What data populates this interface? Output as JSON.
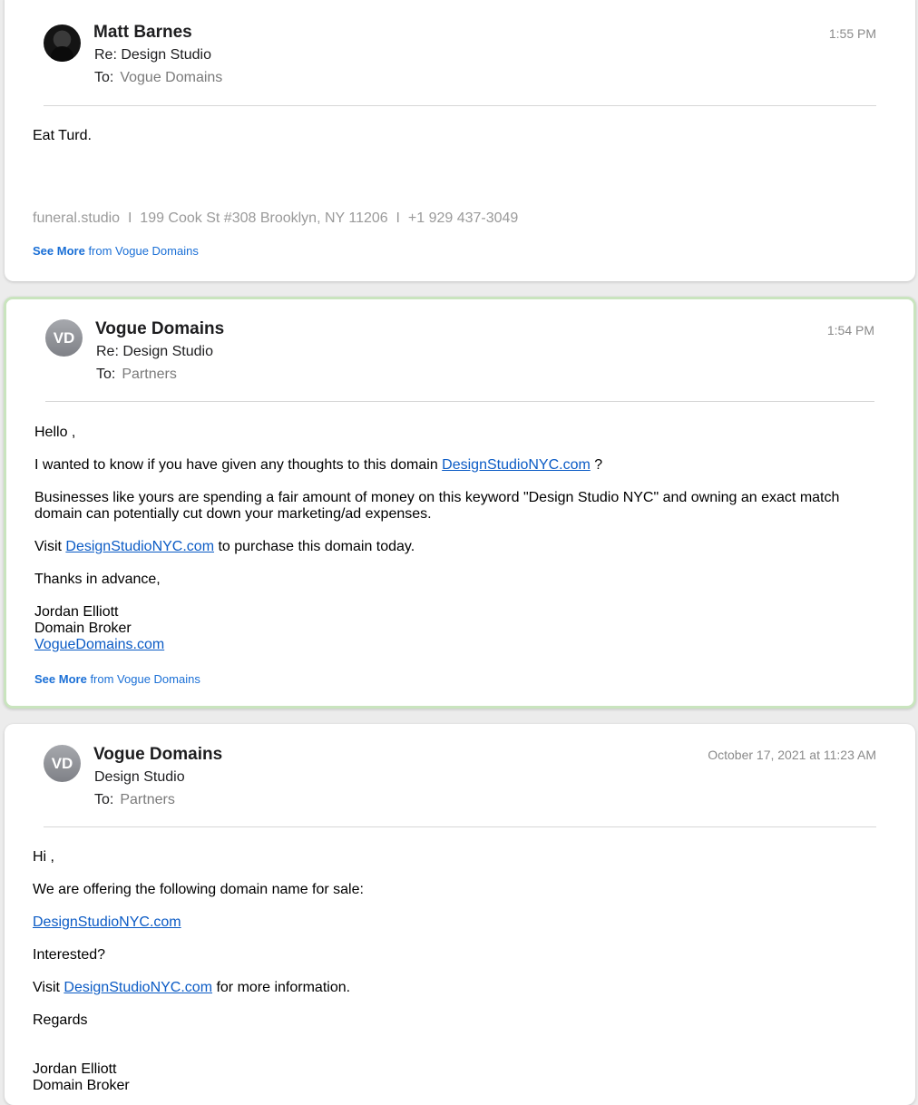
{
  "messages": [
    {
      "sender": "Matt Barnes",
      "subject": "Re: Design Studio",
      "to_label": "To:",
      "to_value": "Vogue Domains",
      "time": "1:55 PM",
      "body": [
        "Eat Turd."
      ],
      "footer": "funeral.studio  I  199 Cook St #308 Brooklyn, NY 11206  I  +1 929 437-3049",
      "see_more_bold": "See More",
      "see_more_rest": "from Vogue Domains"
    },
    {
      "sender": "Vogue Domains",
      "avatar_initials": "VD",
      "subject": "Re: Design Studio",
      "to_label": "To:",
      "to_value": "Partners",
      "time": "1:54 PM",
      "greeting": "Hello ,",
      "p1_text": "I wanted to know if you have given any thoughts to this  domain ",
      "p1_link": "DesignStudioNYC.com",
      "p1_end": " ?",
      "p2": "Businesses like yours are spending a fair amount of money on this keyword  \"Design Studio NYC\" and owning an exact match domain can potentially cut down your marketing/ad expenses.",
      "p3_start": "Visit ",
      "p3_link": "DesignStudioNYC.com",
      "p3_end": " to purchase this domain today.",
      "thanks": "Thanks in advance,",
      "sig_name": "Jordan Elliott",
      "sig_title": "Domain Broker",
      "sig_link": "VogueDomains.com",
      "see_more_bold": "See More",
      "see_more_rest": "from Vogue Domains"
    },
    {
      "sender": "Vogue Domains",
      "avatar_initials": "VD",
      "subject": "Design Studio",
      "to_label": "To:",
      "to_value": "Partners",
      "time": "October 17, 2021 at 11:23 AM",
      "greeting": "Hi ,",
      "p1": "We are offering the following domain name for sale:",
      "domain_link": "DesignStudioNYC.com",
      "interested": "Interested?",
      "p3_start": "Visit ",
      "p3_link": "DesignStudioNYC.com",
      "p3_end": " for more information.",
      "regards": "Regards",
      "sig_name": "Jordan Elliott",
      "sig_title": "Domain Broker"
    }
  ]
}
